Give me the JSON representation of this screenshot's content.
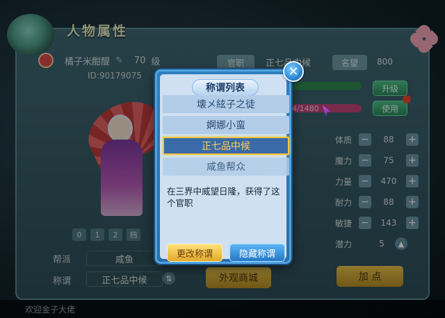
{
  "background_panel": {
    "title": "人物属性",
    "player_name": "橘子米酣醍",
    "level_value": "70",
    "level_unit": "级",
    "player_id": "ID:90179075",
    "official_label": "官职",
    "official_value": "正七品中候",
    "fame_label": "名望",
    "fame_value": "800",
    "upgrade_button": "升级",
    "use_button": "使用",
    "exp_text": "4/1480",
    "left_level_buttons": [
      "0",
      "1",
      "2",
      "档"
    ],
    "clan_label": "帮派",
    "clan_value": "咸鱼",
    "title_label": "称谓",
    "title_value": "正七品中候",
    "shop_button": "外观商城",
    "add_points_button": "加 点",
    "stats": [
      {
        "label": "体质",
        "value": "88"
      },
      {
        "label": "魔力",
        "value": "75"
      },
      {
        "label": "力量",
        "value": "470"
      },
      {
        "label": "耐力",
        "value": "88"
      },
      {
        "label": "敏捷",
        "value": "143"
      }
    ],
    "potential_label": "潜力",
    "potential_value": "5",
    "chat_text": "欢迎金子大佬"
  },
  "modal": {
    "title": "称谓列表",
    "items": [
      {
        "label": "壊メ絃子之徒",
        "selected": false
      },
      {
        "label": "婀娜小蛮",
        "selected": false
      },
      {
        "label": "正七品中候",
        "selected": true
      },
      {
        "label": "咸鱼帮众",
        "selected": false
      }
    ],
    "description": "在三界中威望日隆，获得了这个官职",
    "change_button": "更改称谓",
    "hide_button": "隐藏称谓"
  },
  "icons": {
    "close": "close-icon",
    "minus": "minus-icon",
    "plus": "plus-icon",
    "up": "arrow-up-icon",
    "switch": "switch-icon"
  },
  "colors": {
    "modal_accent": "#2f7fc0",
    "selected_border": "#f2c53d",
    "selected_text": "#ffd24a",
    "change_button": "#e0a92a",
    "hide_button": "#2577c6"
  }
}
